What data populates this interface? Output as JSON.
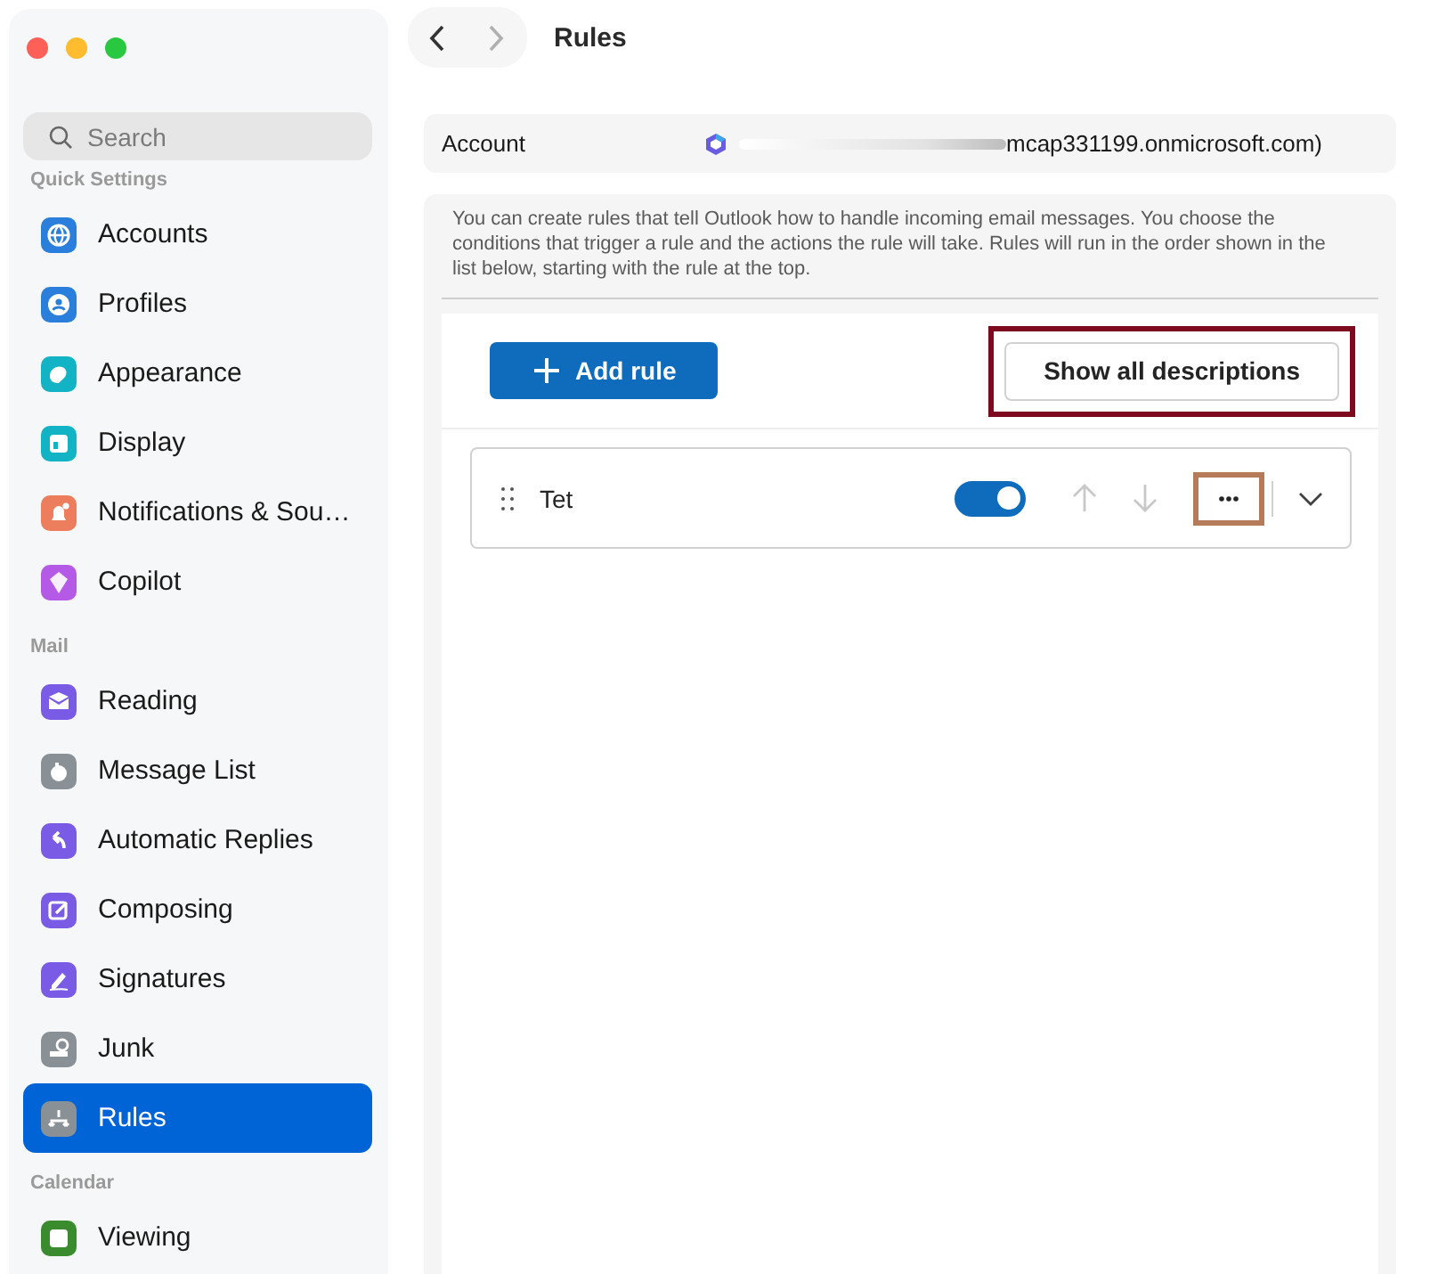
{
  "window": {
    "title": "Rules"
  },
  "sidebar": {
    "search": {
      "placeholder": "Search"
    },
    "sections": [
      {
        "label": "Quick Settings",
        "items": [
          {
            "label": "Accounts",
            "color": "#2a7fdc",
            "selected": false
          },
          {
            "label": "Profiles",
            "color": "#2a7fdc",
            "selected": false
          },
          {
            "label": "Appearance",
            "color": "#12b3c4",
            "selected": false
          },
          {
            "label": "Display",
            "color": "#12b3c4",
            "selected": false
          },
          {
            "label": "Notifications & Sou…",
            "color": "#ec7e5e",
            "selected": false
          },
          {
            "label": "Copilot",
            "color": "#b45ae6",
            "selected": false
          }
        ]
      },
      {
        "label": "Mail",
        "items": [
          {
            "label": "Reading",
            "color": "#7a5be6",
            "selected": false
          },
          {
            "label": "Message List",
            "color": "#8a9196",
            "selected": false
          },
          {
            "label": "Automatic Replies",
            "color": "#7a5be6",
            "selected": false
          },
          {
            "label": "Composing",
            "color": "#7a5be6",
            "selected": false
          },
          {
            "label": "Signatures",
            "color": "#7a5be6",
            "selected": false
          },
          {
            "label": "Junk",
            "color": "#8a9196",
            "selected": false
          },
          {
            "label": "Rules",
            "color": "#8a9196",
            "selected": true
          }
        ]
      },
      {
        "label": "Calendar",
        "items": [
          {
            "label": "Viewing",
            "color": "#3a8a2e",
            "selected": false
          }
        ]
      }
    ]
  },
  "account": {
    "label": "Account",
    "value": "mcap331199.onmicrosoft.com)"
  },
  "description": "You can create rules that tell Outlook how to handle incoming email messages. You choose the conditions that trigger a rule and the actions the rule will take. Rules will run in the order shown in the list below, starting with the rule at the top.",
  "toolbar": {
    "add_button": {
      "label": "Add rule"
    },
    "show_button": {
      "label": "Show all descriptions",
      "highlighted": true
    }
  },
  "rules": [
    {
      "name": "Tet",
      "on": true,
      "move_up_disabled": true,
      "move_down_disabled": true,
      "more_highlighted": true,
      "expanded": false
    }
  ]
}
